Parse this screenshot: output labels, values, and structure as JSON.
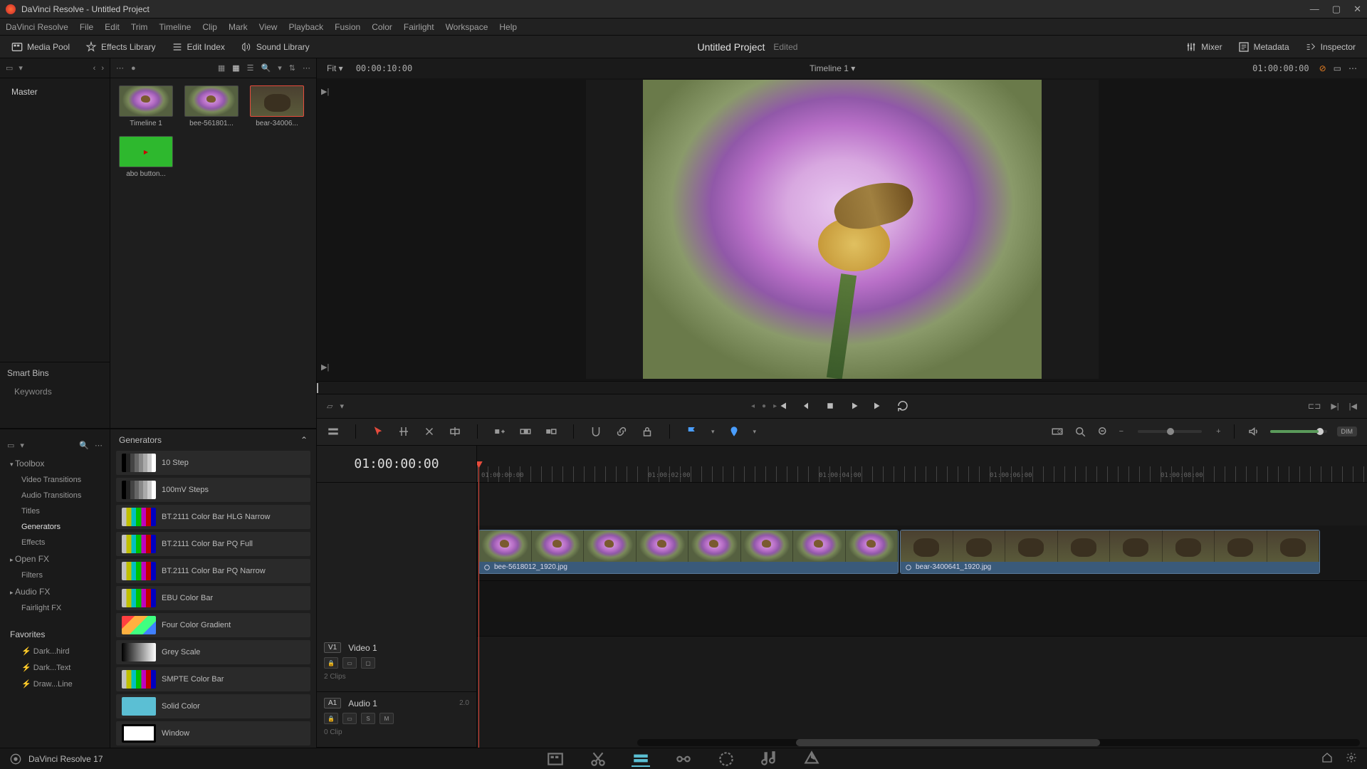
{
  "window": {
    "title": "DaVinci Resolve - Untitled Project"
  },
  "menu": [
    "DaVinci Resolve",
    "File",
    "Edit",
    "Trim",
    "Timeline",
    "Clip",
    "Mark",
    "View",
    "Playback",
    "Fusion",
    "Color",
    "Fairlight",
    "Workspace",
    "Help"
  ],
  "workspace_tools": {
    "media_pool": "Media Pool",
    "effects_library": "Effects Library",
    "edit_index": "Edit Index",
    "sound_library": "Sound Library",
    "mixer": "Mixer",
    "metadata": "Metadata",
    "inspector": "Inspector"
  },
  "project": {
    "title": "Untitled Project",
    "edited": "Edited"
  },
  "viewer_bar": {
    "fit": "Fit",
    "src_tc": "00:00:10:00",
    "timeline_name": "Timeline 1",
    "rec_tc": "01:00:00:00"
  },
  "bins": {
    "master": "Master",
    "smart_hdr": "Smart Bins",
    "keywords": "Keywords"
  },
  "clips": [
    {
      "label": "Timeline 1",
      "kind": "flower"
    },
    {
      "label": "bee-561801...",
      "kind": "flower"
    },
    {
      "label": "bear-34006...",
      "kind": "bear",
      "selected": true
    },
    {
      "label": "abo button...",
      "kind": "green"
    }
  ],
  "fx_tree": {
    "toolbox": "Toolbox",
    "video_transitions": "Video Transitions",
    "audio_transitions": "Audio Transitions",
    "titles": "Titles",
    "generators": "Generators",
    "effects": "Effects",
    "open_fx": "Open FX",
    "filters": "Filters",
    "audio_fx": "Audio FX",
    "fairlight_fx": "Fairlight FX",
    "favorites": "Favorites",
    "fav1": "Dark...hird",
    "fav2": "Dark...Text",
    "fav3": "Draw...Line"
  },
  "fx_panel_hdr": "Generators",
  "generators": [
    {
      "name": "10 Step",
      "sw": "sw-steps"
    },
    {
      "name": "100mV Steps",
      "sw": "sw-steps"
    },
    {
      "name": "BT.2111 Color Bar HLG Narrow",
      "sw": "sw-colorbar"
    },
    {
      "name": "BT.2111 Color Bar PQ Full",
      "sw": "sw-colorbar"
    },
    {
      "name": "BT.2111 Color Bar PQ Narrow",
      "sw": "sw-colorbar"
    },
    {
      "name": "EBU Color Bar",
      "sw": "sw-colorbar"
    },
    {
      "name": "Four Color Gradient",
      "sw": "sw-4color"
    },
    {
      "name": "Grey Scale",
      "sw": "sw-gray"
    },
    {
      "name": "SMPTE Color Bar",
      "sw": "sw-colorbar"
    },
    {
      "name": "Solid Color",
      "sw": "sw-solid"
    },
    {
      "name": "Window",
      "sw": "sw-window"
    }
  ],
  "timeline": {
    "tc": "01:00:00:00",
    "ruler": [
      "01:00:00:00",
      "01:00:02:00",
      "01:00:04:00",
      "01:00:06:00",
      "01:00:08:00"
    ],
    "v1": {
      "tag": "V1",
      "name": "Video 1",
      "meta": "2 Clips"
    },
    "a1": {
      "tag": "A1",
      "name": "Audio 1",
      "ch": "2.0",
      "meta": "0 Clip"
    },
    "clip1": "bee-5618012_1920.jpg",
    "clip2": "bear-3400641_1920.jpg"
  },
  "edit_tools": {
    "dim": "DIM"
  },
  "footer": {
    "app": "DaVinci Resolve 17"
  }
}
